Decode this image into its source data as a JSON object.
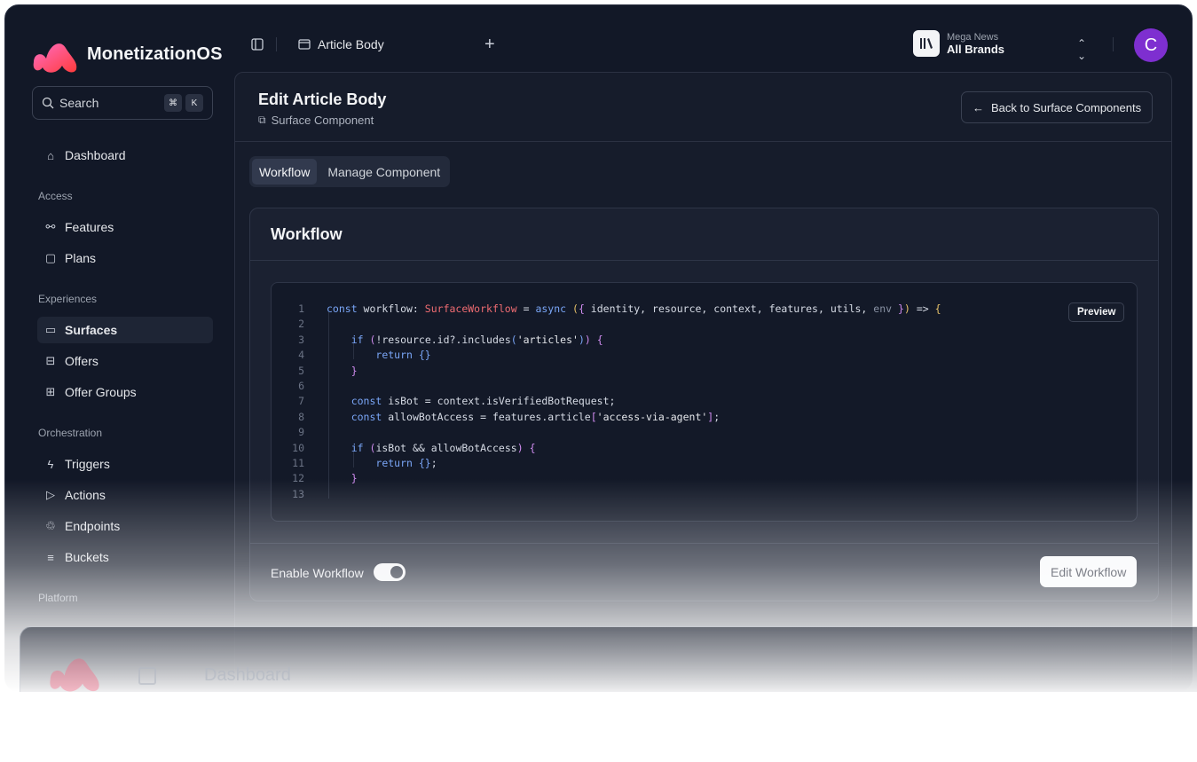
{
  "app": {
    "name": "MonetizationOS"
  },
  "topbar": {
    "tab_title": "Article Body",
    "brand_sub": "Mega News",
    "brand_main": "All Brands",
    "avatar_letter": "C"
  },
  "sidebar": {
    "search_placeholder": "Search",
    "shortcut_mod": "⌘",
    "shortcut_key": "K",
    "dashboard": "Dashboard",
    "sections": {
      "access": "Access",
      "experiences": "Experiences",
      "orchestration": "Orchestration",
      "platform": "Platform"
    },
    "items": {
      "features": "Features",
      "plans": "Plans",
      "surfaces": "Surfaces",
      "offers": "Offers",
      "offer_groups": "Offer Groups",
      "triggers": "Triggers",
      "actions": "Actions",
      "endpoints": "Endpoints",
      "buckets": "Buckets"
    }
  },
  "main": {
    "title": "Edit Article Body",
    "subtitle": "Surface Component",
    "back_button": "Back to Surface Components",
    "tabs": [
      "Workflow",
      "Manage Component"
    ],
    "card_title": "Workflow",
    "preview_button": "Preview",
    "enable_label": "Enable Workflow",
    "enable_on": true,
    "edit_button": "Edit Workflow",
    "code_line_numbers": [
      "1",
      "2",
      "3",
      "4",
      "5",
      "6",
      "7",
      "8",
      "9",
      "10",
      "11",
      "12",
      "13"
    ]
  },
  "reflection": {
    "text": "Dashboard"
  },
  "colors": {
    "accent": "#7e2fd0",
    "logo_pink": "#ff4f8b",
    "logo_red": "#ff5a5f"
  }
}
